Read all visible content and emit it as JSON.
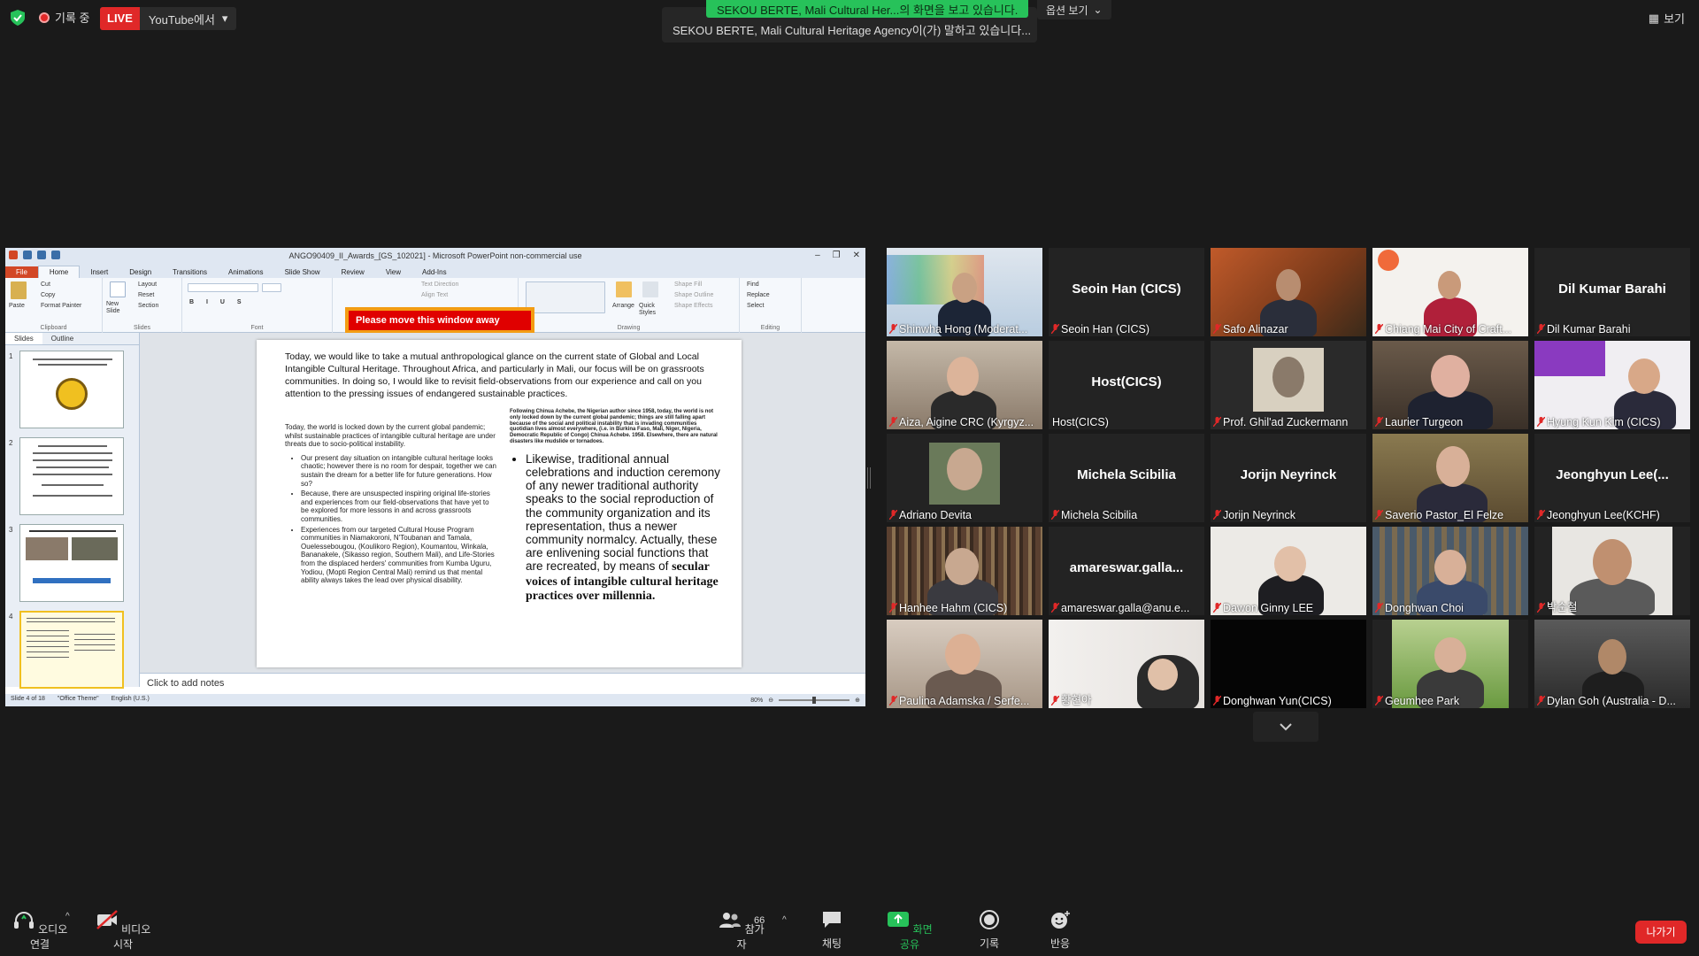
{
  "topbar": {
    "recording_label": "기록 중",
    "live_badge": "LIVE",
    "live_destination": "YouTube에서",
    "share_banner": "SEKOU  BERTE, Mali Cultural Her...의 화면을 보고 있습니다.",
    "share_banner_under": "SEKOU  BERTE, Mali Cultural Heritage Agency이(가) 말하고 있습니다...",
    "view_options": "옵션 보기",
    "gallery_view": "보기"
  },
  "ppt": {
    "window_title": "ANGO90409_II_Awards_[GS_102021] - Microsoft PowerPoint non-commercial use",
    "tabs": [
      "File",
      "Home",
      "Insert",
      "Design",
      "Transitions",
      "Animations",
      "Slide Show",
      "Review",
      "View",
      "Add-Ins"
    ],
    "ribbon": {
      "paste": "Paste",
      "cut": "Cut",
      "copy": "Copy",
      "format_painter": "Format Painter",
      "clipboard": "Clipboard",
      "new_slide": "New Slide",
      "layout": "Layout",
      "reset": "Reset",
      "section": "Section",
      "slides": "Slides",
      "font": "Font",
      "text_direction": "Text Direction",
      "align_text": "Align Text",
      "arrange": "Arrange",
      "quick_styles": "Quick Styles",
      "shape_fill": "Shape Fill",
      "shape_outline": "Shape Outline",
      "shape_effects": "Shape Effects",
      "drawing": "Drawing",
      "find": "Find",
      "replace": "Replace",
      "select": "Select",
      "editing": "Editing"
    },
    "move_banner": "Please move this window away",
    "pane_tabs": [
      "Slides",
      "Outline"
    ],
    "slide_numbers": [
      "1",
      "2",
      "3",
      "4"
    ],
    "slide": {
      "intro": "Today, we would like to take a mutual anthropological glance on the current state of Global and Local Intangible Cultural Heritage.  Throughout Africa, and particularly in Mali, our focus will be on grassroots communities. In doing so, I would like to revisit field-observations from our experience and call on you attention to the pressing issues of endangered sustainable practices.",
      "left_lead": "Today, the world is locked down by  the current global pandemic; whilst  sustainable practices of intangible cultural heritage are under threats due to  socio-political instability.",
      "left_bullets": [
        "Our present day situation on intangible cultural heritage looks chaotic; however there is no room  for despair, together we can sustain the dream for a better life for future generations. How so?",
        "Because, there are unsuspected inspiring original life-stories and experiences from our field-observations that have yet to be explored for more lessons in and across grassroots communities.",
        "Experiences from our targeted Cultural House Program communities in Niamakoroni,  N'Toubanan and Tamala, Ouelessebougou, (Koulikoro Region), Koumantou,  Winkala, Bananakele, (Sikasso region, Southern  Mali), and Life-Stories from the displaced herders' communities  from Kumba Uguru, Yodiou, (Mopti Region Central Mali) remind  us that mental ability always takes the lead over physical disability."
      ],
      "right_lead": "Following Chinua Achebe, the Nigerian author since 1958, today, the world is not only locked down by the current global pandemic; things are still falling apart because of the social and political instability that is invading communities quotidian lives almost everywhere, (i.e. in Burkina Faso, Mali, Niger, Nigeria, Democratic Republic of Congo) Chinua Achebe. 1958.  Elsewhere, there are natural disasters like mudslide or tornadoes.",
      "right_bullet": "Likewise, traditional annual celebrations and induction ceremony of any newer traditional authority speaks to the social reproduction of the community organization and its representation, thus a newer community normalcy. Actually, these are enlivening social functions that are recreated, by means of",
      "right_bullet_bold": "secular voices of intangible  cultural heritage practices over millennia."
    },
    "notes_placeholder": "Click to add notes",
    "status": {
      "slide_of": "Slide 4 of 18",
      "theme": "\"Office Theme\"",
      "language": "English (U.S.)",
      "zoom": "80%"
    }
  },
  "participants": [
    {
      "name": "Shinwha Hong (Moderat...",
      "video": true
    },
    {
      "name": "Seoin Han (CICS)",
      "center": "Seoin Han (CICS)",
      "video": false
    },
    {
      "name": "Safo Alinazar",
      "video": true
    },
    {
      "name": "Chiang Mai City of Craft...",
      "video": true
    },
    {
      "name": "Dil Kumar Barahi",
      "center": "Dil Kumar Barahi",
      "video": false
    },
    {
      "name": "Aiza, Aigine CRC (Kyrgyz...",
      "video": true
    },
    {
      "name": "Host(CICS)",
      "center": "Host(CICS)",
      "video": false
    },
    {
      "name": "Prof. Ghil'ad Zuckermann",
      "video": true
    },
    {
      "name": "Laurier Turgeon",
      "video": true
    },
    {
      "name": "Hyung Kun Kim (CICS)",
      "video": true
    },
    {
      "name": "Adriano Devita",
      "video": true
    },
    {
      "name": "Michela Scibilia",
      "center": "Michela Scibilia",
      "video": false
    },
    {
      "name": "Jorijn Neyrinck",
      "center": "Jorijn Neyrinck",
      "video": false
    },
    {
      "name": "Saverio Pastor_El Felze",
      "video": true
    },
    {
      "name": "Jeonghyun Lee(KCHF)",
      "center": "Jeonghyun  Lee(...",
      "video": false
    },
    {
      "name": "Hanhee Hahm (CICS)",
      "video": true
    },
    {
      "name": "amareswar.galla@anu.e...",
      "center": "amareswar.galla...",
      "video": false
    },
    {
      "name": "Dawon Ginny LEE",
      "video": true
    },
    {
      "name": "Donghwan Choi",
      "video": true
    },
    {
      "name": "박순철",
      "video": true
    },
    {
      "name": "Paulina Adamska / Serfe...",
      "video": true
    },
    {
      "name": "황현아",
      "video": true
    },
    {
      "name": "Donghwan Yun(CICS)",
      "video": true
    },
    {
      "name": "Geumhee Park",
      "video": true
    },
    {
      "name": "Dylan Goh (Australia - D...",
      "video": true
    }
  ],
  "toolbar": {
    "audio": "오디오 연결",
    "video": "비디오 시작",
    "participants": "참가자",
    "participant_count": "66",
    "chat": "채팅",
    "share": "화면 공유",
    "record": "기록",
    "reactions": "반응",
    "leave": "나가기"
  },
  "colors": {
    "live": "#e02828",
    "share_green": "#27c25a",
    "banner_orange": "#f39c12",
    "banner_red": "#e00000"
  }
}
